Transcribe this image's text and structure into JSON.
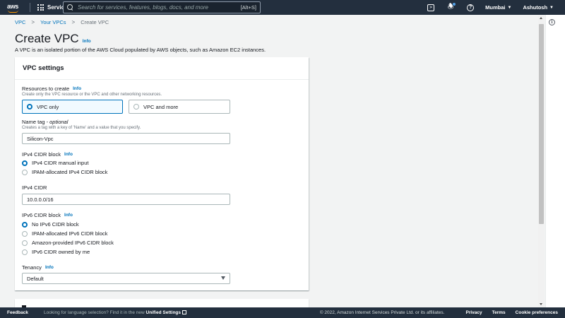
{
  "topnav": {
    "logo_text": "aws",
    "services_label": "Services",
    "search_placeholder": "Search for services, features, blogs, docs, and more",
    "search_shortcut": "[Alt+S]",
    "region": "Mumbai",
    "user": "Ashutosh",
    "icons": [
      "cloudshell-icon",
      "bell-icon",
      "help-icon"
    ]
  },
  "breadcrumb": {
    "items": [
      "VPC",
      "Your VPCs",
      "Create VPC"
    ]
  },
  "page": {
    "title": "Create VPC",
    "info": "Info",
    "description": "A VPC is an isolated portion of the AWS Cloud populated by AWS objects, such as Amazon EC2 instances."
  },
  "vpc_settings": {
    "title": "VPC settings",
    "resources": {
      "label": "Resources to create",
      "info": "Info",
      "description": "Create only the VPC resource or the VPC and other networking resources.",
      "options": [
        "VPC only",
        "VPC and more"
      ],
      "selected": "VPC only"
    },
    "name_tag": {
      "label": "Name tag - ",
      "optional": "optional",
      "description": "Creates a tag with a key of 'Name' and a value that you specify.",
      "value": "Silicon-Vpc"
    },
    "ipv4_block": {
      "label": "IPv4 CIDR block",
      "info": "Info",
      "options": [
        "IPv4 CIDR manual input",
        "IPAM-allocated IPv4 CIDR block"
      ],
      "selected": "IPv4 CIDR manual input"
    },
    "ipv4_cidr": {
      "label": "IPv4 CIDR",
      "value": "10.0.0.0/16"
    },
    "ipv6_block": {
      "label": "IPv6 CIDR block",
      "info": "Info",
      "options": [
        "No IPv6 CIDR block",
        "IPAM-allocated IPv6 CIDR block",
        "Amazon-provided IPv6 CIDR block",
        "IPv6 CIDR owned by me"
      ],
      "selected": "No IPv6 CIDR block"
    },
    "tenancy": {
      "label": "Tenancy",
      "info": "Info",
      "value": "Default"
    }
  },
  "footer": {
    "feedback": "Feedback",
    "lang_prefix": "Looking for language selection? Find it in the new",
    "lang_link": "Unified Settings",
    "copyright": "© 2022, Amazon Internet Services Private Ltd. or its affiliates.",
    "links": [
      "Privacy",
      "Terms",
      "Cookie preferences"
    ]
  },
  "colors": {
    "nav_bg": "#232f3e",
    "link": "#0073bb",
    "accent": "#ff9900"
  }
}
